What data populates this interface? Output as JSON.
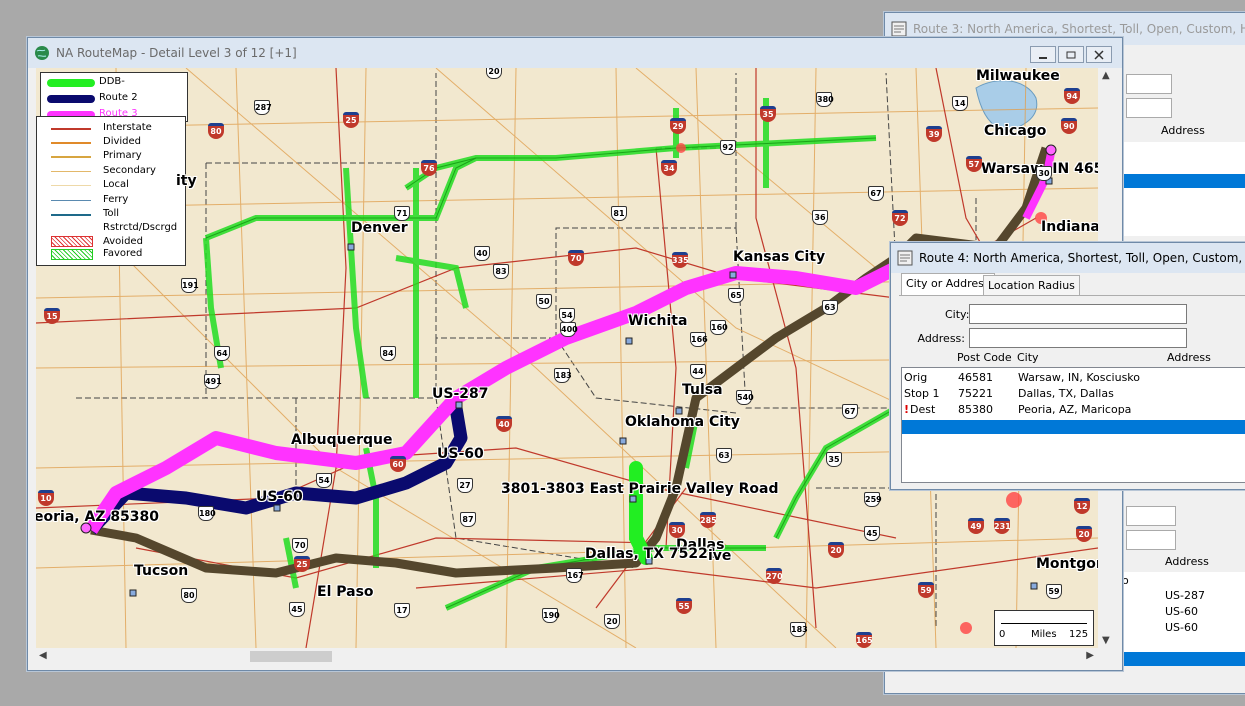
{
  "route3_window": {
    "title": "Route 3: North America, Shortest, Toll, Open, Custom, Highwa",
    "col_address": "Address",
    "col_address2": "Address",
    "rows": [
      "US-287",
      "US-60",
      "US-60"
    ],
    "partial_char": "o"
  },
  "route4_window": {
    "title": "Route 4: North America, Shortest, Toll, Open, Custom, Highwa",
    "tabs": [
      "City or Address",
      "Location Radius"
    ],
    "city_label": "City:",
    "address_label": "Address:",
    "city_value": "",
    "address_value": "",
    "columns": {
      "type": "",
      "post_code": "Post Code",
      "city": "City",
      "address": "Address"
    },
    "stops": [
      {
        "type": "Orig",
        "flag": "",
        "post_code": "46581",
        "city": "Warsaw, IN, Kosciusko",
        "address": ""
      },
      {
        "type": "Stop 1",
        "flag": "",
        "post_code": "75221",
        "city": "Dallas, TX, Dallas",
        "address": ""
      },
      {
        "type": "Dest",
        "flag": "!",
        "post_code": "85380",
        "city": "Peoria, AZ, Maricopa",
        "address": ""
      }
    ]
  },
  "map_window": {
    "title": "NA RouteMap - Detail Level 3 of 12 [+1]",
    "legend_routes": [
      {
        "label": "DDB-",
        "color": "#22ee22"
      },
      {
        "label": "Route 2",
        "color": "#0a0a6e"
      },
      {
        "label": "Route 3",
        "color": "#ff33ff"
      }
    ],
    "legend_items": [
      {
        "label": "Interstate",
        "color": "#c0392b"
      },
      {
        "label": "Divided",
        "color": "#e08a2a"
      },
      {
        "label": "Primary",
        "color": "#d7a540"
      },
      {
        "label": "Secondary",
        "color": "#e3b86a"
      },
      {
        "label": "Local",
        "color": "#eed9a8"
      },
      {
        "label": "Ferry",
        "color": "#5a8ab0"
      },
      {
        "label": "Toll",
        "color": "#1e6a8a"
      },
      {
        "label": "Rstrctd/Dscrgd",
        "color": ""
      },
      {
        "label": "Avoided",
        "color": "#dd3333"
      },
      {
        "label": "Favored",
        "color": "#22cc22"
      }
    ],
    "cities": {
      "milwaukee": "Milwaukee",
      "chicago": "Chicago",
      "warsaw": "Warsaw, IN 465",
      "indianapolis": "Indianap",
      "kansas_city": "Kansas City",
      "denver": "Denver",
      "wichita": "Wichita",
      "tulsa": "Tulsa",
      "oklahoma_city": "Oklahoma City",
      "albuquerque": "Albuquerque",
      "us287": "US-287",
      "us60a": "US-60",
      "us60b": "US-60",
      "prairie": "3801-3803 East Prairie Valley Road",
      "dallas": "Dallas",
      "dallas_stop": "Dallas, TX 75221",
      "dallas_overlap": "ive",
      "peoria": "eoria, AZ 85380",
      "tucson": "Tucson",
      "el_paso": "El Paso",
      "montgomery": "Montgon",
      "city_partial": "ity"
    },
    "scale": {
      "left": "0",
      "unit": "Miles",
      "right": "125"
    },
    "shields": [
      "20",
      "287",
      "80",
      "25",
      "380",
      "35",
      "29",
      "39",
      "14",
      "90",
      "94",
      "76",
      "34",
      "92",
      "30",
      "57",
      "71",
      "81",
      "72",
      "67",
      "36",
      "40",
      "83",
      "70",
      "335",
      "65",
      "15",
      "191",
      "50",
      "54",
      "400",
      "160",
      "166",
      "63",
      "64",
      "491",
      "84",
      "183",
      "44",
      "540",
      "40",
      "67",
      "27",
      "87",
      "60",
      "54",
      "180",
      "70",
      "10",
      "80",
      "25",
      "45",
      "190",
      "17",
      "20",
      "59",
      "167",
      "285",
      "30",
      "35",
      "63",
      "259",
      "270",
      "49",
      "20",
      "183",
      "165",
      "12",
      "59",
      "231",
      "20",
      "85",
      "55",
      "45",
      "61"
    ]
  },
  "accent_colors": {
    "route_ddb": "#22ee22",
    "route2": "#0a0a6e",
    "route3": "#ff33ff",
    "route4": "#55472d",
    "selection": "#0078d7"
  }
}
